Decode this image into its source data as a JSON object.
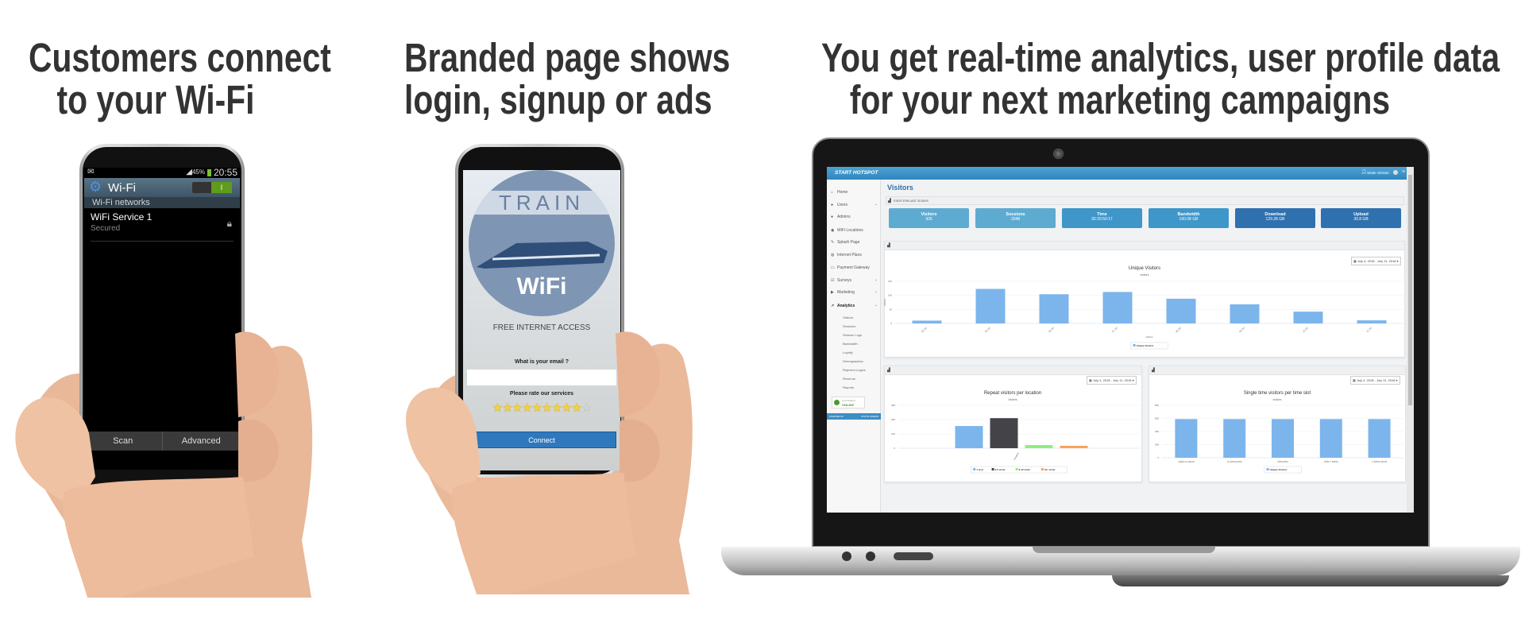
{
  "headings": {
    "col1": [
      "Customers connect",
      "to your Wi-Fi"
    ],
    "col2": [
      "Branded page shows",
      "login, signup or ads"
    ],
    "col3": [
      "You get real-time analytics, user profile data",
      "for your next marketing campaigns"
    ]
  },
  "phone1": {
    "status_battery": "45%",
    "status_time": "20:55",
    "title": "Wi-Fi",
    "toggle_on": true,
    "section": "Wi-Fi networks",
    "networks": [
      {
        "name": "WiFi Service 1",
        "status": "Secured",
        "icon": "wifi-lock-icon"
      }
    ],
    "buttons": [
      "Scan",
      "Advanced"
    ]
  },
  "phone2": {
    "logo_top": "TRAIN",
    "logo_bottom": "WiFi",
    "headline": "FREE INTERNET ACCESS",
    "email_label": "What is your email ?",
    "email_value": "",
    "rating_label": "Please rate our services",
    "rating": 9,
    "rating_max": 10,
    "connect_label": "Connect",
    "accent": "#2f78bd"
  },
  "dashboard": {
    "brand": "START HOTSPOT",
    "user": "Wade Sinister",
    "sidebar": {
      "items": [
        "Home",
        "Users",
        "Admins",
        "WiFi Locations",
        "Splash Page",
        "Internet Plans",
        "Payment Gateway",
        "Surveys",
        "Marketing",
        "Analytics"
      ],
      "analytics_sub": [
        "Visitors",
        "Sessions",
        "Session Logs",
        "Bandwidth",
        "Loyalty",
        "Demographics",
        "Rejected Logins",
        "Revenue",
        "Reports"
      ],
      "live_support": [
        "Live Support",
        "ONLINE"
      ],
      "footer": [
        "LICENSE OK",
        "INVITE FRIEND"
      ]
    },
    "page_title": "Visitors",
    "stats_header": "STATS FOR LAST 30 DAYS",
    "stats": [
      {
        "label": "Visitors",
        "value": "926",
        "color": "#5eabd2"
      },
      {
        "label": "Sessions",
        "value": "2048",
        "color": "#5eabd2"
      },
      {
        "label": "Time",
        "value": "92:20:50:17",
        "color": "#3f96c8"
      },
      {
        "label": "Bandwidth",
        "value": "160.08 GB",
        "color": "#3f96c8"
      },
      {
        "label": "Download",
        "value": "129.28 GB",
        "color": "#2e71ae"
      },
      {
        "label": "Upload",
        "value": "30.8 GB",
        "color": "#2e71ae"
      }
    ],
    "date_range": "July 4, 2018 - July 11, 2018"
  },
  "chart_data": [
    {
      "type": "bar",
      "title": "Unique Visitors",
      "subtitle": "visitors",
      "xlabel": "visitors",
      "ylabel": "visitors",
      "categories": [
        "04 Jul",
        "05 Jul",
        "06 Jul",
        "07 Jul",
        "08 Jul",
        "09 Jul",
        "10 Jul",
        "11 Jul"
      ],
      "series": [
        {
          "name": "Unique Visitors",
          "values": [
            10,
            123,
            104,
            112,
            88,
            68,
            42,
            11
          ],
          "color": "#7cb5ec"
        }
      ],
      "ylim": [
        0,
        150
      ],
      "yticks": [
        0,
        50,
        100,
        150
      ],
      "grid": true,
      "legend": "bottom"
    },
    {
      "type": "bar",
      "title": "Repeat visitors per location",
      "subtitle": "Visitors",
      "categories": [
        "location"
      ],
      "series": [
        {
          "name": "1 visit",
          "values": [
            155
          ],
          "color": "#7cb5ec"
        },
        {
          "name": "2-5 visits",
          "values": [
            210
          ],
          "color": "#434348"
        },
        {
          "name": "6-10 visits",
          "values": [
            22
          ],
          "color": "#90ed7d"
        },
        {
          "name": "10+ visits",
          "values": [
            17
          ],
          "color": "#f7a35c"
        }
      ],
      "ylim": [
        0,
        300
      ],
      "yticks": [
        0,
        100,
        200,
        300
      ],
      "grid": true,
      "legend": "bottom"
    },
    {
      "type": "bar",
      "title": "Single time visitors per time slot",
      "subtitle": "visitors",
      "categories": [
        "10AM-11:30AM",
        "11:30AM-2PM",
        "2PM-5PM",
        "5PM-7:30PM",
        "7:30PM-11PM"
      ],
      "series": [
        {
          "name": "Unique Visitors",
          "values": [
            590,
            590,
            590,
            590,
            590
          ],
          "color": "#7cb5ec"
        }
      ],
      "ylim": [
        0,
        800
      ],
      "yticks": [
        0,
        200,
        400,
        600,
        800
      ],
      "grid": true,
      "legend": "bottom"
    }
  ]
}
